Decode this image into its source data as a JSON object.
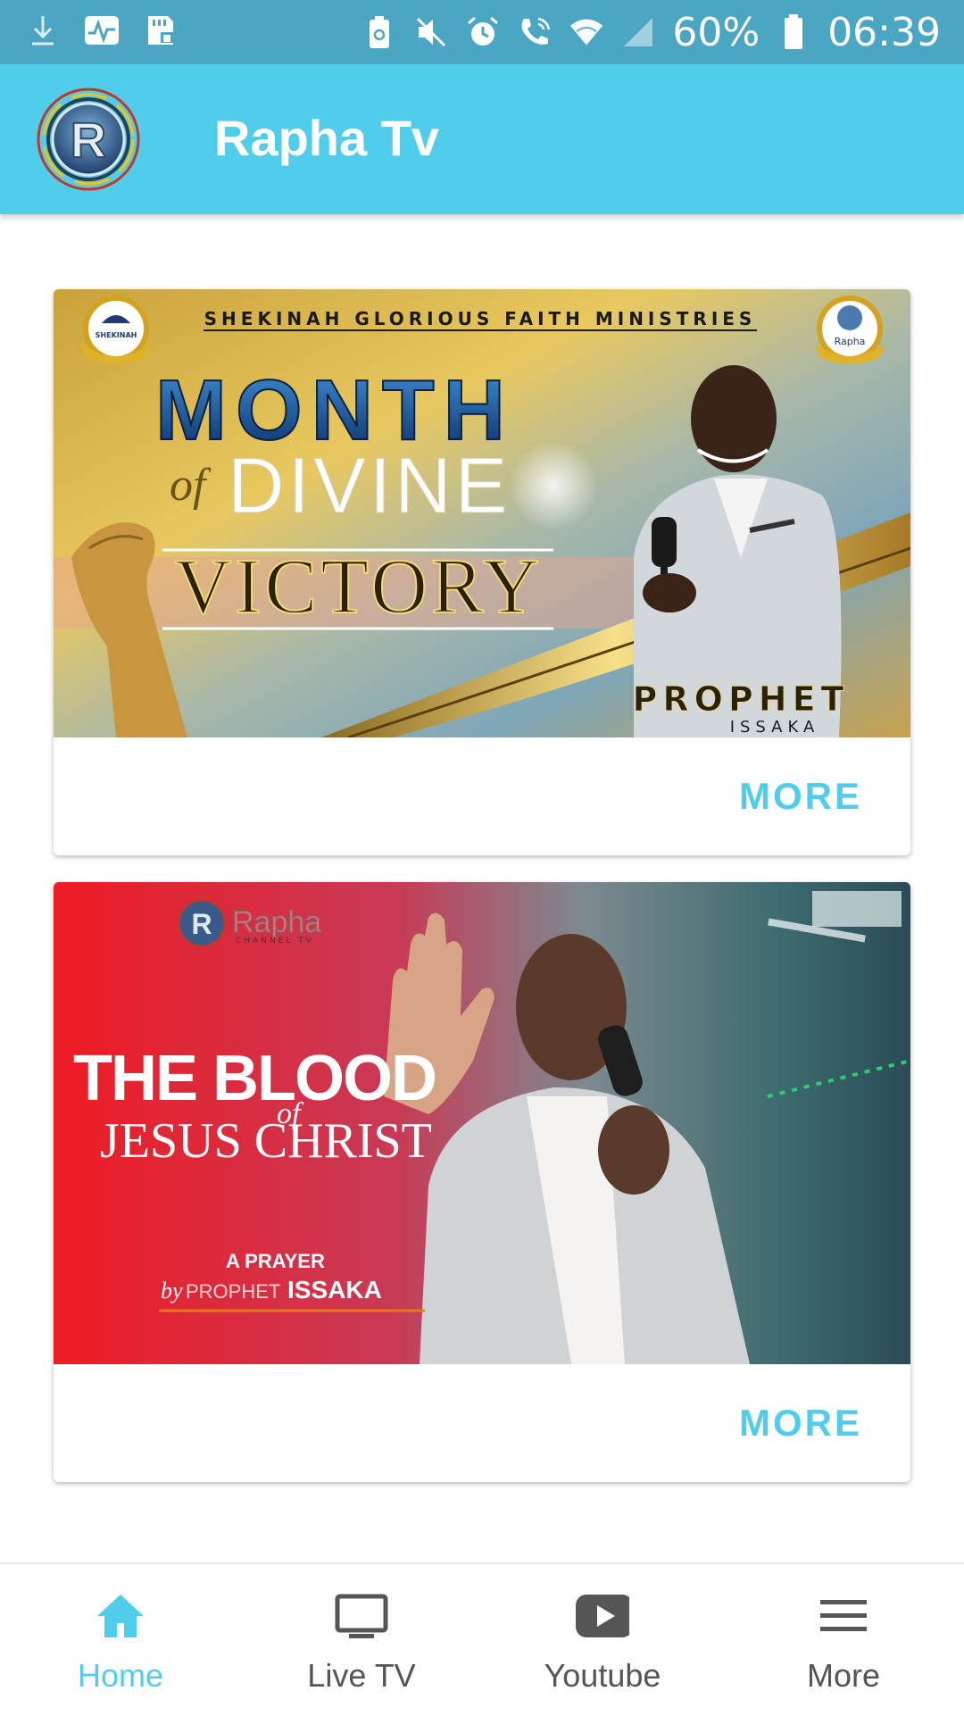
{
  "status_bar": {
    "battery": "60%",
    "time": "06:39",
    "left_icons": [
      "download-icon",
      "activity-icon",
      "sd-card-icon"
    ],
    "right_icons": [
      "battery-saver-icon",
      "mute-icon",
      "alarm-icon",
      "wifi-call-icon",
      "wifi-icon",
      "signal-icon",
      "battery-icon"
    ]
  },
  "app_bar": {
    "title": "Rapha Tv",
    "logo_letter": "R",
    "color": "#51cdec"
  },
  "cards": [
    {
      "header": "SHEKINAH GLORIOUS FAITH MINISTRIES",
      "badge_left": "SHEKINAH",
      "badge_right": "Rapha",
      "line1": "MONTH",
      "of": "of",
      "line2": "DIVINE",
      "line3": "VICTORY",
      "speaker_title": "PROPHET",
      "speaker_name": "ISSAKA",
      "more_label": "MORE"
    },
    {
      "brand": "Rapha",
      "brand_sub": "CHANNEL TV",
      "title1": "THE BLOOD",
      "of": "of",
      "title2": "JESUS CHRIST",
      "prayer": "A PRAYER",
      "by": "by",
      "prophet": "PROPHET",
      "name": "ISSAKA",
      "more_label": "MORE"
    }
  ],
  "bottom_nav": {
    "items": [
      {
        "label": "Home",
        "icon": "home-icon",
        "active": true
      },
      {
        "label": "Live TV",
        "icon": "tv-icon",
        "active": false
      },
      {
        "label": "Youtube",
        "icon": "youtube-icon",
        "active": false
      },
      {
        "label": "More",
        "icon": "menu-icon",
        "active": false
      }
    ],
    "active_color": "#51cdec",
    "inactive_color": "#555555"
  }
}
